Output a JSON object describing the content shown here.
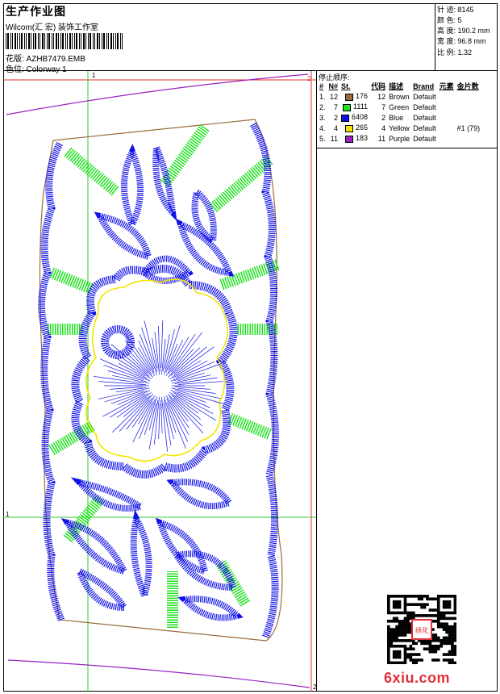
{
  "header": {
    "title": "生产作业图",
    "company": "Wilcom(汇 宏) 装饰工作室",
    "filename": "花版:   AZHB7479.EMB",
    "colorway": "色位:   Colorway 1"
  },
  "stats": [
    "针 迹:  8145",
    "颜 色:  5",
    "高 度:  190.2 mm",
    "宽 度:  96.8 mm",
    "比 例:  1.32"
  ],
  "stop_sequence": {
    "title": "停止顺序:",
    "columns": [
      "#",
      "N#",
      "St.",
      "代码",
      "描述",
      "Brand",
      "元素",
      "金片数"
    ],
    "rows": [
      {
        "idx": "1.",
        "n": "12",
        "color": "#9a6b3c",
        "st": "176",
        "code": "12",
        "desc": "Brown",
        "brand": "Default",
        "element": "",
        "sequins": ""
      },
      {
        "idx": "2.",
        "n": "7",
        "color": "#1ee01e",
        "st": "1111",
        "code": "7",
        "desc": "Green",
        "brand": "Default",
        "element": "",
        "sequins": ""
      },
      {
        "idx": "3.",
        "n": "2",
        "color": "#1010e8",
        "st": "6408",
        "code": "2",
        "desc": "Blue",
        "brand": "Default",
        "element": "",
        "sequins": ""
      },
      {
        "idx": "4.",
        "n": "4",
        "color": "#f2e600",
        "st": "265",
        "code": "4",
        "desc": "Yellow",
        "brand": "Default",
        "element": "",
        "sequins": "#1 (79)"
      },
      {
        "idx": "5.",
        "n": "11",
        "color": "#9a1fc2",
        "st": "183",
        "code": "11",
        "desc": "Purple",
        "brand": "Default",
        "element": "",
        "sequins": ""
      }
    ]
  },
  "markers": {
    "m1_top": "1",
    "m2_top": "2",
    "m1_left": "1",
    "m2_bottom": "2"
  },
  "watermark": "6xiu.com",
  "qr_badge": "绣花",
  "colors": {
    "brown": "#9a6b3c",
    "green": "#1ee01e",
    "blue": "#1010e8",
    "yellow": "#f2e600",
    "purple": "#9a1fc2",
    "red": "#e0303a"
  }
}
